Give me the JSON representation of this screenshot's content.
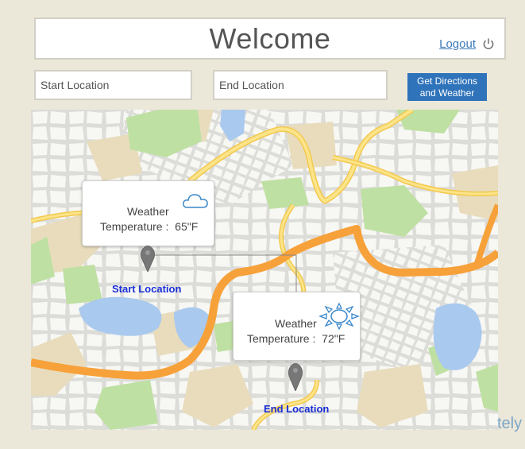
{
  "header": {
    "title": "Welcome",
    "logout_label": "Logout"
  },
  "search": {
    "start_placeholder": "Start Location",
    "end_placeholder": "End Location",
    "button_label": "Get Directions and Weather"
  },
  "map": {
    "start": {
      "label": "Start Location",
      "weather_label": "Weather",
      "temperature_label": "Temperature :",
      "temperature_value": "65\"F",
      "icon": "cloud-icon"
    },
    "end": {
      "label": "End Location",
      "weather_label": "Weather",
      "temperature_label": "Temperature :",
      "temperature_value": "72\"F",
      "icon": "sun-icon"
    }
  },
  "brand": {
    "text": "tely"
  },
  "colors": {
    "page_bg": "#ece8d9",
    "button": "#2f73ba",
    "route": "#f7a13a",
    "road": "#f9d767",
    "water": "#a9c9ee",
    "park": "#bfe0a3",
    "link": "#3a7ab8",
    "map_label": "#1a2fd8"
  }
}
